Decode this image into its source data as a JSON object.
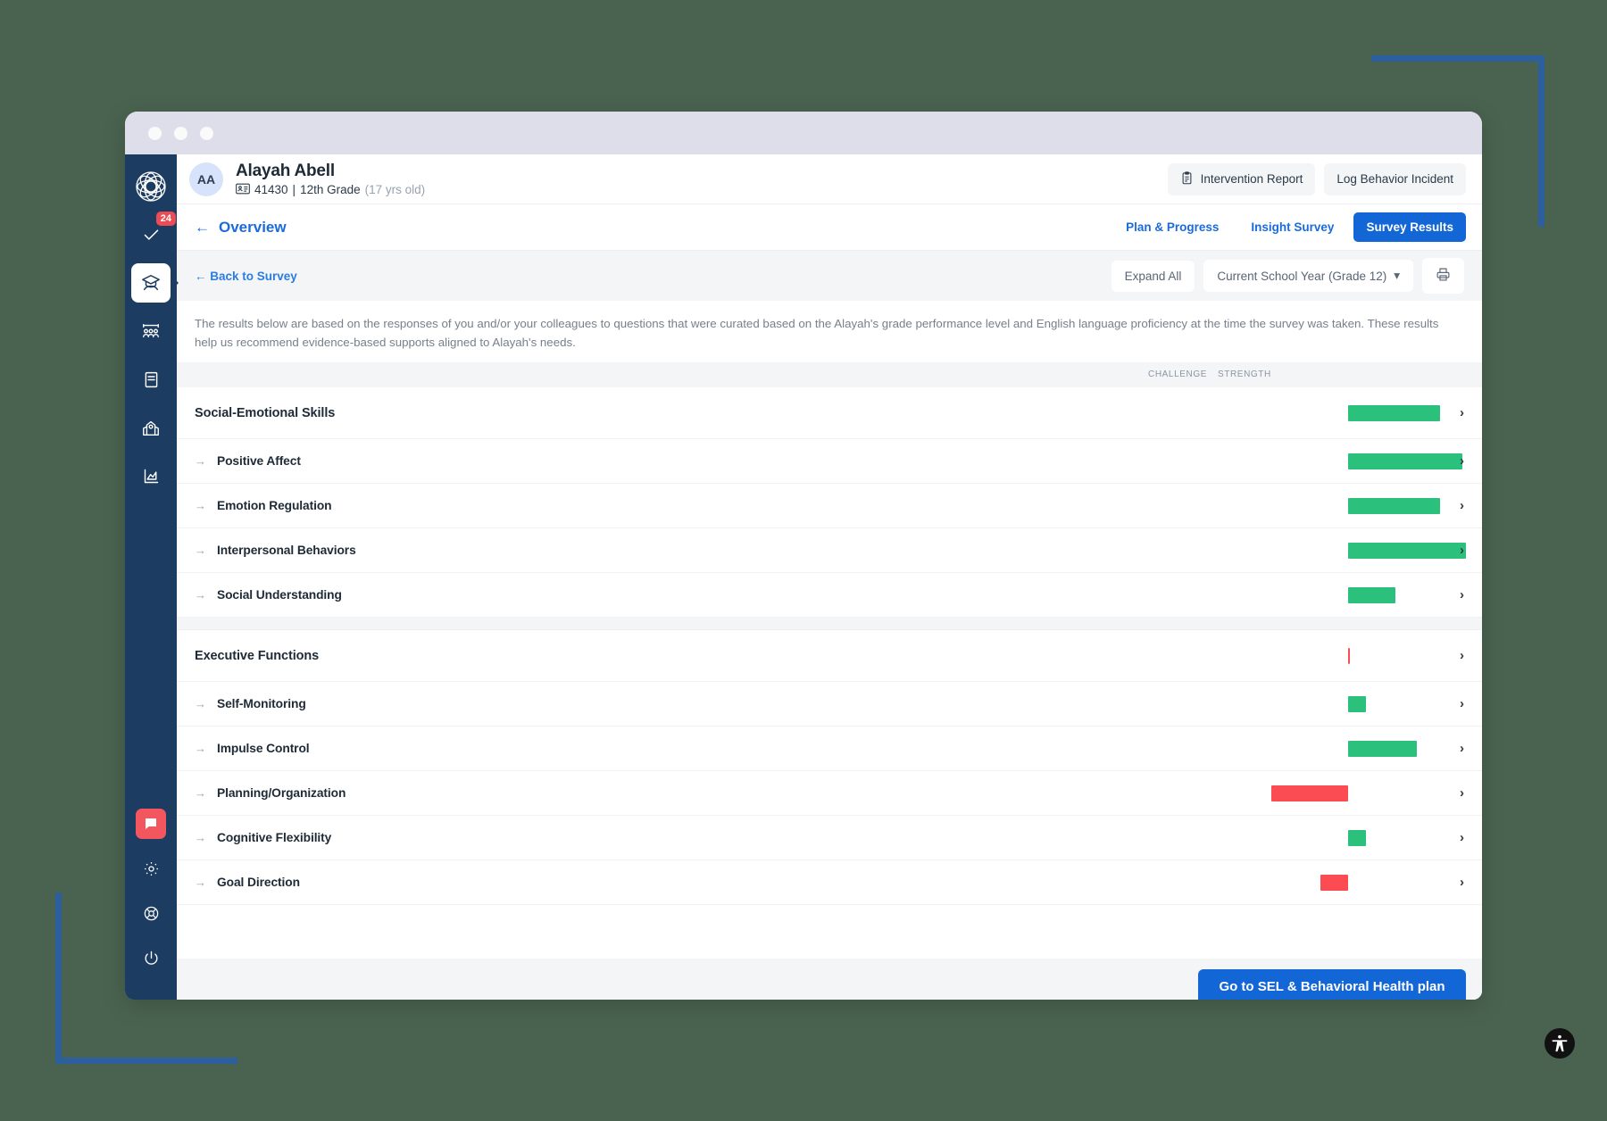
{
  "window": {
    "dots": [
      "",
      "",
      ""
    ]
  },
  "sidebar": {
    "logo_name": "app-logo",
    "items": [
      {
        "name": "tasks",
        "icon": "check-badge-icon",
        "badge": "24",
        "active": false
      },
      {
        "name": "students",
        "icon": "student-graduate-icon",
        "badge": "",
        "active": true
      },
      {
        "name": "groups",
        "icon": "group-people-icon",
        "badge": "",
        "active": false
      },
      {
        "name": "library",
        "icon": "book-icon",
        "badge": "",
        "active": false
      },
      {
        "name": "school",
        "icon": "school-building-icon",
        "badge": "",
        "active": false
      },
      {
        "name": "reports",
        "icon": "chart-area-icon",
        "badge": "",
        "active": false
      }
    ],
    "bottom": [
      {
        "name": "chat",
        "icon": "chat-bubble-icon"
      },
      {
        "name": "settings",
        "icon": "gear-icon"
      },
      {
        "name": "support",
        "icon": "lifebuoy-icon"
      },
      {
        "name": "logout",
        "icon": "power-icon"
      }
    ]
  },
  "student": {
    "initials": "AA",
    "name": "Alayah Abell",
    "id_icon": "id-card-icon",
    "id": "41430",
    "separator": "|",
    "grade": "12th Grade",
    "age": "(17 yrs old)"
  },
  "header_actions": [
    {
      "label": "Intervention Report",
      "icon": "clipboard-icon",
      "name": "intervention-report-button"
    },
    {
      "label": "Log Behavior Incident",
      "icon": "",
      "name": "log-behavior-incident-button"
    }
  ],
  "nav": {
    "back_arrow": "←",
    "overview": "Overview",
    "tabs": [
      {
        "label": "Plan & Progress",
        "active": false
      },
      {
        "label": "Insight Survey",
        "active": false
      },
      {
        "label": "Survey Results",
        "active": true
      }
    ]
  },
  "toolbar": {
    "back_to_survey": "← Back to Survey",
    "expand_all": "Expand All",
    "school_year": "Current School Year (Grade 12)",
    "caret": "▾",
    "print_icon": "printer-icon"
  },
  "description": "The results below are based on the responses of you and/or your colleagues to questions that were curated based on the Alayah's grade performance level and English language proficiency at the time the survey was taken. These results help us recommend evidence-based supports aligned to Alayah's needs.",
  "legend": {
    "challenge": "CHALLENGE",
    "strength": "STRENGTH"
  },
  "chevron": "›",
  "row_arrow": "→",
  "cta": {
    "label": "Go to SEL & Behavioral Health plan"
  },
  "a11y_icon": "accessibility-icon",
  "colors": {
    "strength": "#2bc07c",
    "challenge": "#fb4b53",
    "accent": "#1366d6",
    "sidebar": "#1d3c61",
    "badge": "#ef4b55"
  },
  "chart_data": {
    "type": "bar",
    "title": "Survey Results",
    "xlabel": "",
    "ylabel": "",
    "axis_labels": [
      "CHALLENGE",
      "STRENGTH"
    ],
    "scale": "diverging, centered at zero; negative = challenge (red), positive = strength (green)",
    "xlim": [
      -100,
      100
    ],
    "grid": false,
    "legend_position": "top-right",
    "sections": [
      {
        "name": "Social-Emotional Skills",
        "value": 47,
        "direction": "strength",
        "items": [
          {
            "label": "Positive Affect",
            "value": 58,
            "direction": "strength"
          },
          {
            "label": "Emotion Regulation",
            "value": 47,
            "direction": "strength"
          },
          {
            "label": "Interpersonal Behaviors",
            "value": 60,
            "direction": "strength"
          },
          {
            "label": "Social Understanding",
            "value": 24,
            "direction": "strength"
          }
        ]
      },
      {
        "name": "Executive Functions",
        "value": 0,
        "direction": "neutral",
        "items": [
          {
            "label": "Self-Monitoring",
            "value": 9,
            "direction": "strength"
          },
          {
            "label": "Impulse Control",
            "value": 35,
            "direction": "strength"
          },
          {
            "label": "Planning/Organization",
            "value": -39,
            "direction": "challenge"
          },
          {
            "label": "Cognitive Flexibility",
            "value": 9,
            "direction": "strength"
          },
          {
            "label": "Goal Direction",
            "value": -14,
            "direction": "challenge"
          }
        ]
      }
    ]
  }
}
